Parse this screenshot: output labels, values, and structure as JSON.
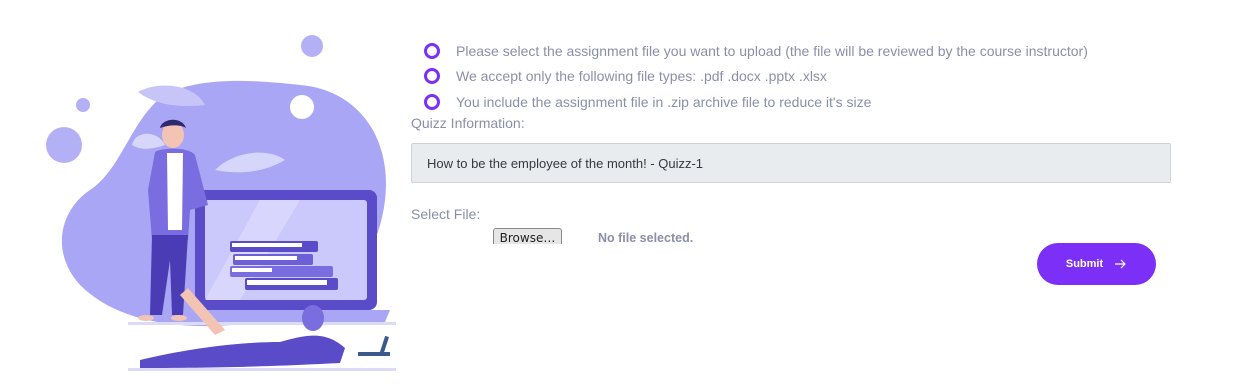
{
  "instructions": [
    "Please select the assignment file you want to upload (the file will be reviewed by the course instructor)",
    "We accept only the following file types: .pdf .docx .pptx .xlsx",
    "You include the assignment file in .zip archive file to reduce it's size"
  ],
  "quiz": {
    "label": "Quizz Information:",
    "value": "How to be the employee of the month! - Quizz-1"
  },
  "file": {
    "label": "Select File:",
    "browse_label": "Browse…",
    "status": "No file selected."
  },
  "submit": {
    "label": "Submit",
    "icon": "arrow-right-icon"
  },
  "colors": {
    "accent": "#7b2ff7",
    "illustration": "#a9a6f5",
    "text": "#8a8fa8",
    "input_bg": "#e9ecef"
  }
}
